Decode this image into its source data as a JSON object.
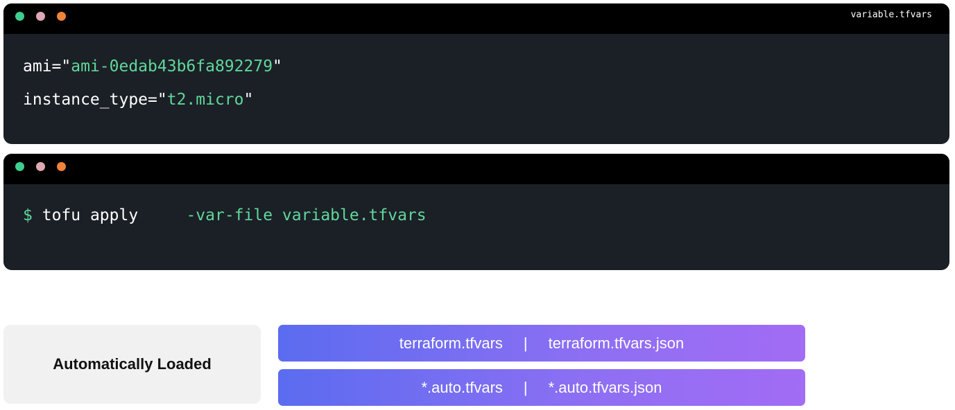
{
  "window_top": {
    "filename": "variable.tfvars",
    "lines": [
      {
        "key": "ami=\"",
        "value": "ami-0edab43b6fa892279",
        "close": "\""
      },
      {
        "key": "instance_type=\"",
        "value": "t2.micro",
        "close": "\""
      }
    ]
  },
  "window_bottom": {
    "prompt": "$",
    "command": "tofu apply",
    "args": "-var-file variable.tfvars"
  },
  "auto_loaded": {
    "label": "Automatically Loaded",
    "rows": [
      {
        "left": "terraform.tfvars",
        "separator": "|",
        "right": "terraform.tfvars.json"
      },
      {
        "left": "*.auto.tfvars",
        "separator": "|",
        "right": "*.auto.tfvars.json"
      }
    ]
  },
  "colors": {
    "terminal_bg": "#1b1f26",
    "titlebar_bg": "#000000",
    "string_green": "#5fd89a",
    "dot_green": "#3ecf8e",
    "dot_pink": "#e0a8b4",
    "dot_orange": "#f0833a",
    "pill_gradient_start": "#5b6cf0",
    "pill_gradient_end": "#a26cf4"
  }
}
